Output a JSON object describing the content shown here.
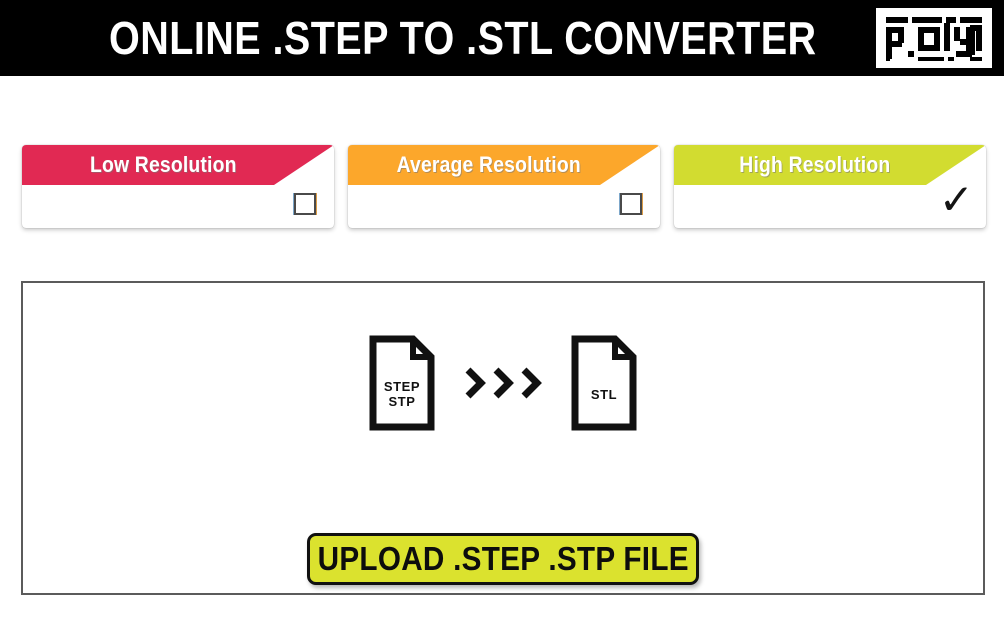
{
  "header": {
    "title": "ONLINE .STEP TO .STL CONVERTER",
    "background": "#000000",
    "text_color": "#ffffff",
    "logo_text": "polyD"
  },
  "resolution_cards": [
    {
      "label": "Low Resolution",
      "color": "#e12953",
      "selected": false,
      "indicator": "empty-checkbox"
    },
    {
      "label": "Average Resolution",
      "color": "#fca72b",
      "selected": false,
      "indicator": "empty-checkbox"
    },
    {
      "label": "High Resolution",
      "color": "#d2dc30",
      "selected": true,
      "indicator": "checkmark",
      "check_glyph": "✓"
    }
  ],
  "panel": {
    "source_file": {
      "line1": "STEP",
      "line2": "STP"
    },
    "target_file": {
      "line1": "STL"
    },
    "arrow_count": 3,
    "upload_button": {
      "label": "UPLOAD .STEP .STP FILE",
      "background": "#dbe22e",
      "text_color": "#0d0d0d"
    }
  }
}
